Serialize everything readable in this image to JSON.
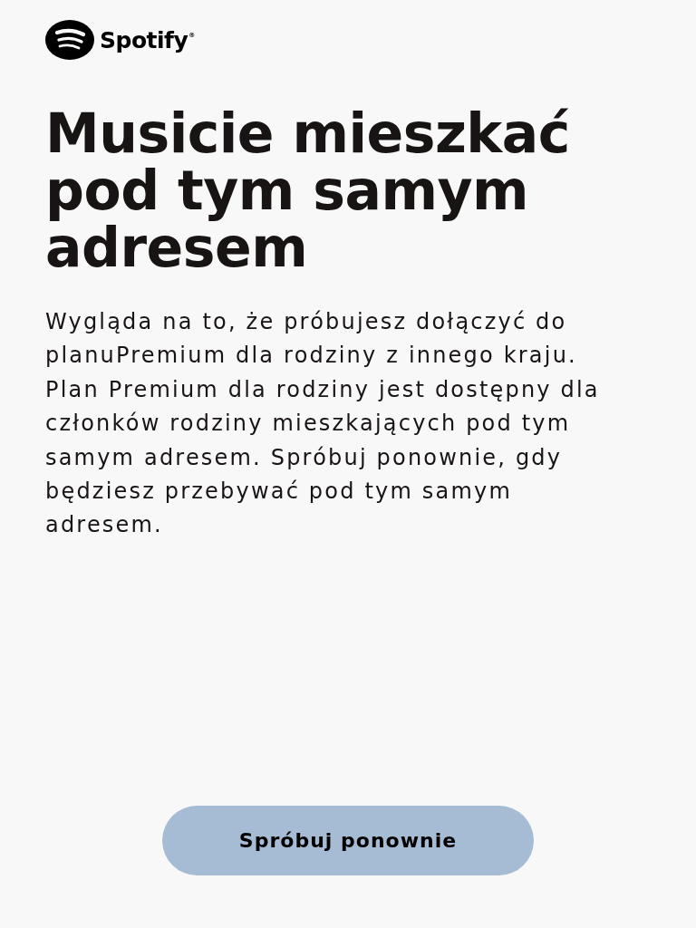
{
  "logo": {
    "wordmark": "Spotify",
    "mark": "®"
  },
  "heading": "Musicie mieszkać pod tym samym adresem",
  "message": "Wygląda na to, że próbujesz dołączyć do planuPremium dla rodziny z innego kraju. Plan Premium dla rodziny jest dostępny dla członków rodziny mieszkających pod tym samym adresem. Spróbuj ponownie, gdy będziesz przebywać pod tym samym adresem.",
  "button": {
    "label": "Spróbuj ponownie",
    "color": "#a6bcd4"
  }
}
